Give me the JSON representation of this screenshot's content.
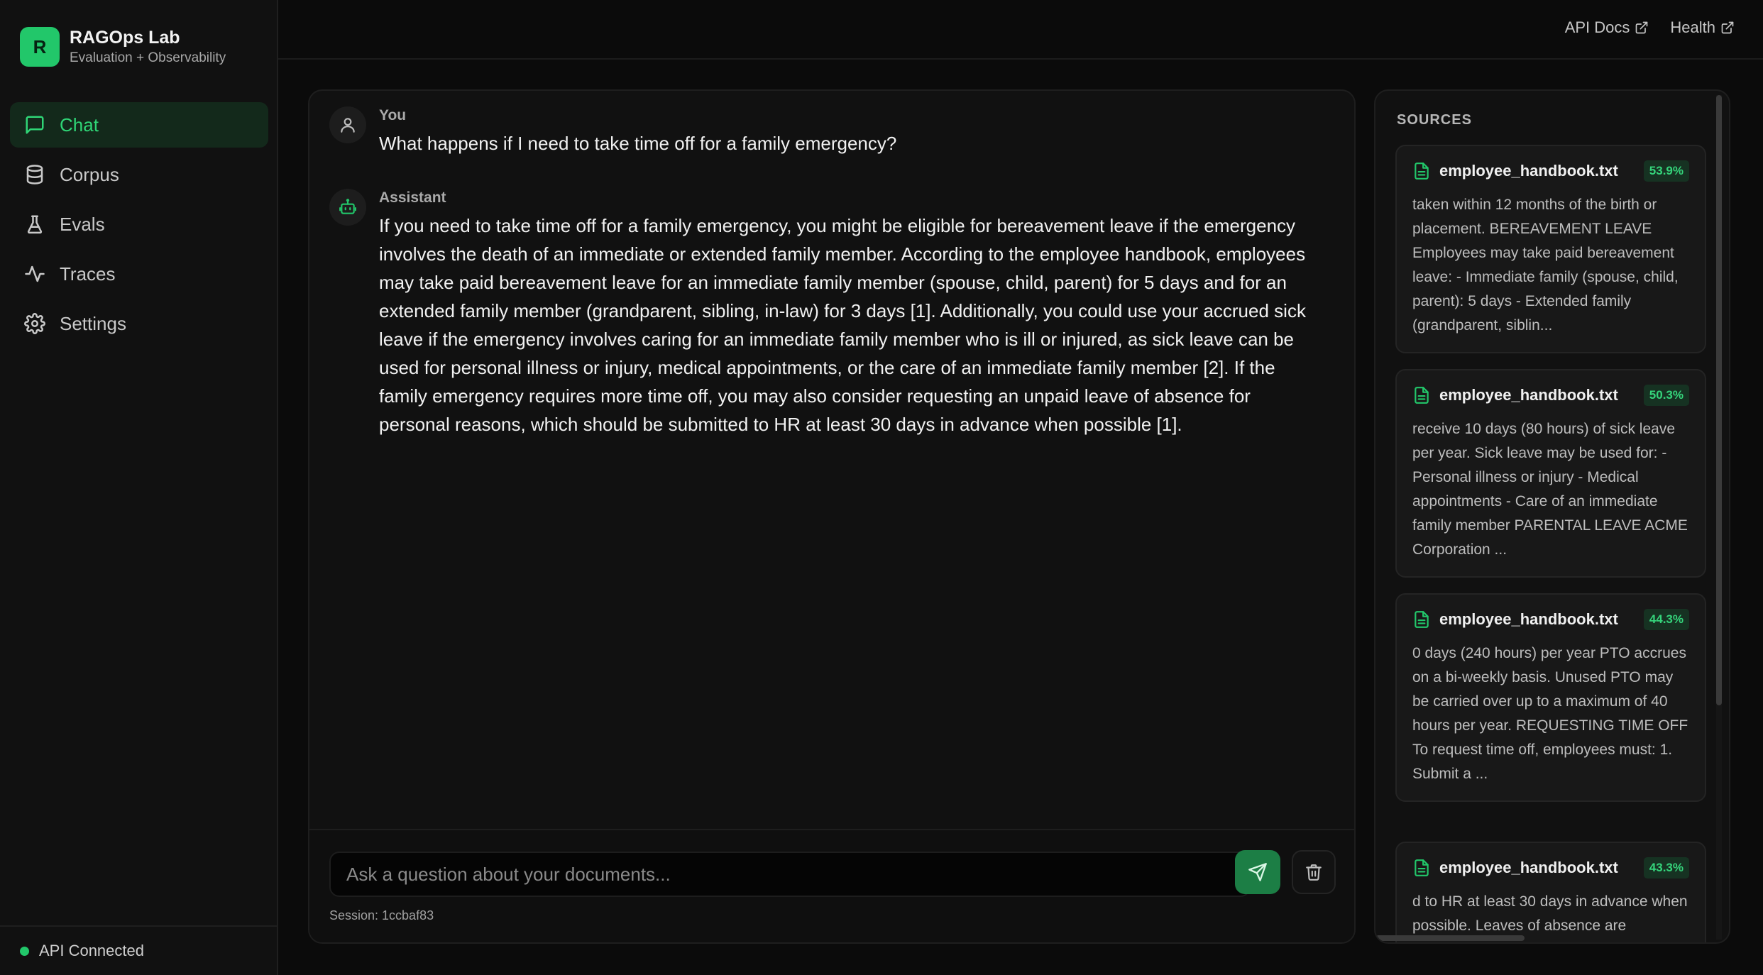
{
  "brand": {
    "logo_letter": "R",
    "title": "RAGOps Lab",
    "subtitle": "Evaluation + Observability"
  },
  "nav": [
    {
      "label": "Chat",
      "icon": "chat-icon",
      "active": true
    },
    {
      "label": "Corpus",
      "icon": "database-icon",
      "active": false
    },
    {
      "label": "Evals",
      "icon": "flask-icon",
      "active": false
    },
    {
      "label": "Traces",
      "icon": "activity-icon",
      "active": false
    },
    {
      "label": "Settings",
      "icon": "gear-icon",
      "active": false
    }
  ],
  "status": {
    "label": "API Connected",
    "color": "#22c76a"
  },
  "topbar": {
    "api_docs": "API Docs",
    "health": "Health"
  },
  "messages": [
    {
      "role": "You",
      "icon": "user-icon",
      "text": "What happens if I need to take time off for a family emergency?"
    },
    {
      "role": "Assistant",
      "icon": "bot-icon",
      "text": "If you need to take time off for a family emergency, you might be eligible for bereavement leave if the emergency involves the death of an immediate or extended family member. According to the employee handbook, employees may take paid bereavement leave for an immediate family member (spouse, child, parent) for 5 days and for an extended family member (grandparent, sibling, in-law) for 3 days [1]. Additionally, you could use your accrued sick leave if the emergency involves caring for an immediate family member who is ill or injured, as sick leave can be used for personal illness or injury, medical appointments, or the care of an immediate family member [2]. If the family emergency requires more time off, you may also consider requesting an unpaid leave of absence for personal reasons, which should be submitted to HR at least 30 days in advance when possible [1]."
    }
  ],
  "composer": {
    "placeholder": "Ask a question about your documents...",
    "value": "",
    "session": "Session: 1ccbaf83"
  },
  "sources": {
    "title": "SOURCES",
    "items": [
      {
        "name": "employee_handbook.txt",
        "score": "53.9%",
        "text": "taken within 12 months of the birth or placement. BEREAVEMENT LEAVE Employees may take paid bereavement leave: - Immediate family (spouse, child, parent): 5 days - Extended family (grandparent, siblin..."
      },
      {
        "name": "employee_handbook.txt",
        "score": "50.3%",
        "text": "receive 10 days (80 hours) of sick leave per year. Sick leave may be used for: - Personal illness or injury - Medical appointments - Care of an immediate family member PARENTAL LEAVE ACME Corporation ..."
      },
      {
        "name": "employee_handbook.txt",
        "score": "44.3%",
        "text": "0 days (240 hours) per year PTO accrues on a bi-weekly basis. Unused PTO may be carried over up to a maximum of 40 hours per year. REQUESTING TIME OFF To request time off, employees must: 1. Submit a ..."
      },
      {
        "name": "employee_handbook.txt",
        "score": "43.3%",
        "text": "d to HR at least 30 days in advance when possible. Leaves of absence are"
      }
    ]
  },
  "colors": {
    "accent": "#22c76a",
    "active_nav_bg": "#13291b",
    "send_button": "#1c7e45"
  }
}
